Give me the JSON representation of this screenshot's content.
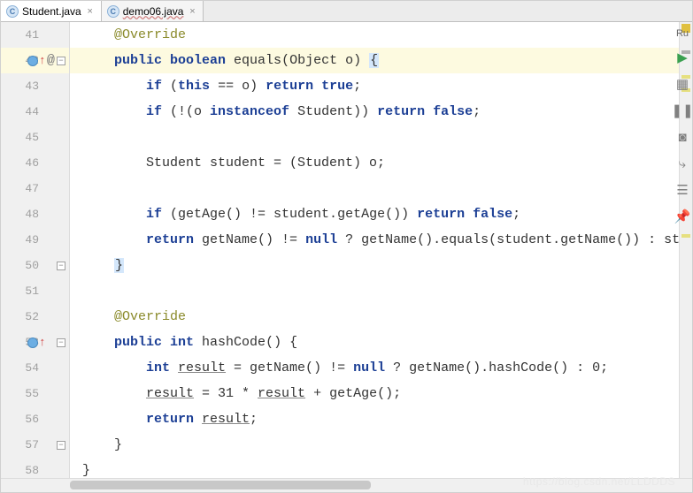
{
  "tabs": [
    {
      "icon": "C",
      "label": "Student.java",
      "active": true,
      "modified": false
    },
    {
      "icon": "C",
      "label": "demo06.java",
      "active": false,
      "modified": true
    }
  ],
  "side_label": "Ru",
  "lines": [
    {
      "n": "41"
    },
    {
      "n": "42",
      "hl": true,
      "fold": true,
      "marks": [
        "recur",
        "arrowup",
        "at"
      ]
    },
    {
      "n": "43"
    },
    {
      "n": "44"
    },
    {
      "n": "45"
    },
    {
      "n": "46"
    },
    {
      "n": "47"
    },
    {
      "n": "48"
    },
    {
      "n": "49"
    },
    {
      "n": "50",
      "fold": true
    },
    {
      "n": "51"
    },
    {
      "n": "52"
    },
    {
      "n": "53",
      "fold": true,
      "marks": [
        "recur",
        "arrowup"
      ]
    },
    {
      "n": "54"
    },
    {
      "n": "55"
    },
    {
      "n": "56"
    },
    {
      "n": "57",
      "fold": true
    },
    {
      "n": "58"
    }
  ],
  "code": {
    "l41": {
      "indent": "    ",
      "ann": "@Override"
    },
    "l42": {
      "indent": "    ",
      "k1": "public boolean ",
      "fn": "equals",
      "p1": "(Object o) ",
      "brace": "{"
    },
    "l43": {
      "indent": "        ",
      "k1": "if",
      "t1": " (",
      "k2": "this",
      "t2": " == o) ",
      "k3": "return true",
      "t3": ";"
    },
    "l44": {
      "indent": "        ",
      "k1": "if",
      "t1": " (!(o ",
      "k2": "instanceof",
      "t2": " Student)) ",
      "k3": "return false",
      "t3": ";"
    },
    "l46": {
      "indent": "        ",
      "t1": "Student student = (Student) o;"
    },
    "l48": {
      "indent": "        ",
      "k1": "if",
      "t1": " (getAge() != student.getAge()) ",
      "k2": "return false",
      "t2": ";"
    },
    "l49": {
      "indent": "        ",
      "k1": "return",
      "t1": " getName() != ",
      "k2": "null",
      "t2": " ? getName().equals(student.getName()) : student.ge"
    },
    "l50": {
      "indent": "    ",
      "brace": "}"
    },
    "l52": {
      "indent": "    ",
      "ann": "@Override"
    },
    "l53": {
      "indent": "    ",
      "k1": "public int ",
      "fn": "hashCode",
      "t1": "() {"
    },
    "l54": {
      "indent": "        ",
      "k1": "int ",
      "u1": "result",
      "t1": " = getName() != ",
      "k2": "null",
      "t2": " ? getName().hashCode() : 0;"
    },
    "l55": {
      "indent": "        ",
      "u1": "result",
      "t1": " = 31 * ",
      "u2": "result",
      "t2": " + getAge();"
    },
    "l56": {
      "indent": "        ",
      "k1": "return ",
      "u1": "result",
      "t1": ";"
    },
    "l57": {
      "indent": "    ",
      "t1": "}"
    },
    "l58": {
      "indent": "",
      "t1": "}"
    }
  },
  "watermark": "https://blog.csdn.net/LLDDDS"
}
